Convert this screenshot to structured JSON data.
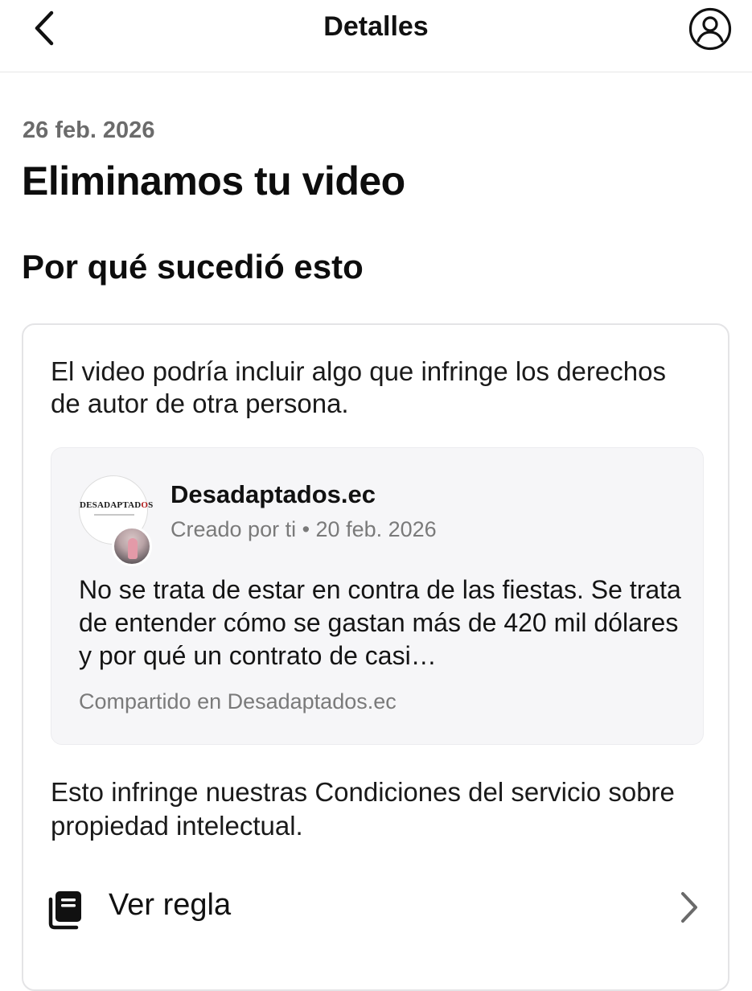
{
  "header": {
    "title": "Detalles",
    "back_icon": "chevron-left-icon",
    "profile_icon": "user-circle-icon"
  },
  "notice": {
    "date": "26 feb. 2026",
    "headline": "Eliminamos tu video",
    "section_title": "Por qué sucedió esto"
  },
  "card": {
    "reason": "El video podría incluir algo que infringe los derechos de autor de otra persona.",
    "post": {
      "author": "Desadaptados.ec",
      "avatar_logo_text": "DESADAPTADOS",
      "meta": "Creado por ti • 20 feb. 2026",
      "text": "No se trata de estar en contra de las fiestas. Se trata de entender cómo se gastan más de 420 mil dólares y por qué un contrato de casi…",
      "shared_in": "Compartido en Desadaptados.ec"
    },
    "policy": "Esto infringe nuestras Condiciones del servicio sobre propiedad intelectual.",
    "rule_link": {
      "label": "Ver regla",
      "icon": "book-icon",
      "chevron": "chevron-right-icon"
    }
  }
}
